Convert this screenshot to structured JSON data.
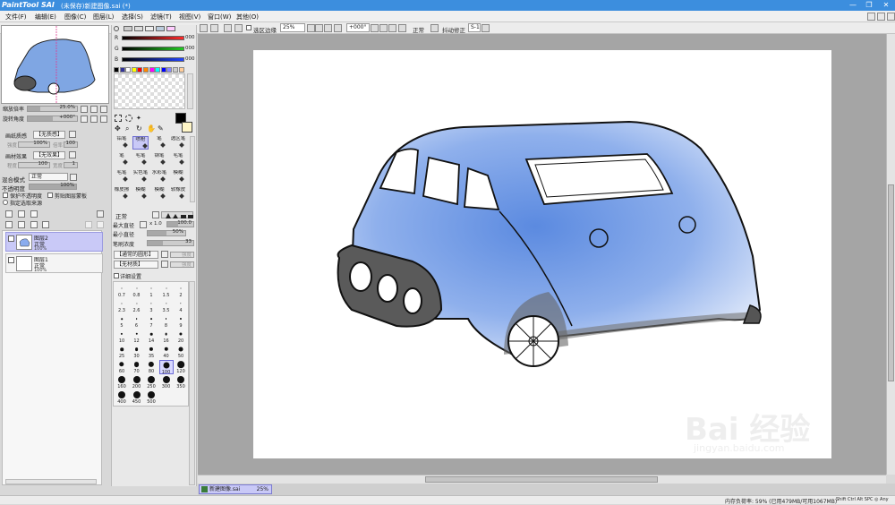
{
  "titlebar": {
    "logo": "PaintTool SAI",
    "title": "(未保存)新建图像.sai (*)",
    "minimize": "—",
    "restore": "❐",
    "close": "✕"
  },
  "menu": [
    "文件(F)",
    "编辑(E)",
    "图像(C)",
    "图层(L)",
    "选择(S)",
    "滤镜(T)",
    "视图(V)",
    "窗口(W)",
    "其他(O)"
  ],
  "toolbar": {
    "selection_edge_label": "选区边缘",
    "zoom_value": "25%",
    "rotation_value": "+000°",
    "mode_value": "正常",
    "stabilizer_label": "抖动修正",
    "stabilizer_value": "S-1"
  },
  "navigator": {
    "zoom_label": "缩放倍率",
    "zoom_value": "25.0%",
    "angle_label": "旋转角度",
    "angle_value": "+000°"
  },
  "layer_props": {
    "paper_texture_label": "画纸质感",
    "paper_texture_value": "【无质感】",
    "intensity_label": "强度",
    "intensity_value": "100%",
    "magnification_label": "倍率",
    "magnification_value": "100",
    "paper_effect_label": "画材效果",
    "paper_effect_value": "【无效果】",
    "degree_label": "程度",
    "degree_value": "100",
    "width_label": "宽度",
    "width_value": "1",
    "blend_label": "混合模式",
    "blend_value": "正常",
    "opacity_label": "不透明度",
    "opacity_value": "100%",
    "protect_opacity": "保护不透明度",
    "clip_group": "剪贴图层蒙板",
    "selection_source": "指定选取来源"
  },
  "layers": [
    {
      "name": "图层2",
      "mode": "正常",
      "opacity": "100%",
      "active": true
    },
    {
      "name": "图层1",
      "mode": "正常",
      "opacity": "100%",
      "active": false
    }
  ],
  "color": {
    "r_label": "R",
    "r_value": "000",
    "g_label": "G",
    "g_value": "000",
    "b_label": "B",
    "b_value": "000",
    "r_color": "#ff2a2a",
    "g_color": "#22cc22",
    "b_color": "#2244ff",
    "swatches": [
      "#000000",
      "#333399",
      "#ffffff",
      "#ffff00",
      "#ff0000",
      "#ff8800",
      "#ff00ff",
      "#00ffff",
      "#0000ff",
      "#8888ff",
      "#cccccc",
      "#ffcc99"
    ]
  },
  "tools": [
    [
      "铅笔",
      "喷枪",
      "笔",
      "选区笔"
    ],
    [
      "笔",
      "毛笔",
      "钢笔",
      "毛笔"
    ],
    [
      "毛笔",
      "实色笔",
      "水彩笔",
      "模糊"
    ],
    [
      "橡皮擦",
      "模糊",
      "模糊",
      "软橡皮"
    ]
  ],
  "brush_settings": {
    "mode_value": "正常",
    "max_size_label": "最大直径",
    "max_size_mult": "x 1.0",
    "max_size_value": "100.0",
    "min_size_label": "最小直径",
    "min_size_value": "50%",
    "density_label": "笔刷浓度",
    "density_value": "33",
    "shape_value": "【通常的圆形】",
    "texture_value": "【无材质】",
    "shape_strength": "强度",
    "detail_label": "详细设置"
  },
  "brush_sizes": [
    "0.7",
    "0.8",
    "1",
    "1.5",
    "2",
    "2.3",
    "2.6",
    "3",
    "3.5",
    "4",
    "5",
    "6",
    "7",
    "8",
    "9",
    "10",
    "12",
    "14",
    "16",
    "20",
    "25",
    "30",
    "35",
    "40",
    "50",
    "60",
    "70",
    "80",
    "100",
    "120",
    "160",
    "200",
    "250",
    "300",
    "350",
    "400",
    "450",
    "500"
  ],
  "active_brush": "100",
  "canvas_tab": {
    "name": "新建图像.sai",
    "zoom": "25%"
  },
  "status": {
    "memory": "内存负荷率: 59% (已用479MB/可用1067MB)",
    "keys": "Shift Ctrl Alt SPC ◎ Any"
  },
  "watermark": "Bai 经验",
  "watermark_url": "jingyan.baidu.com"
}
